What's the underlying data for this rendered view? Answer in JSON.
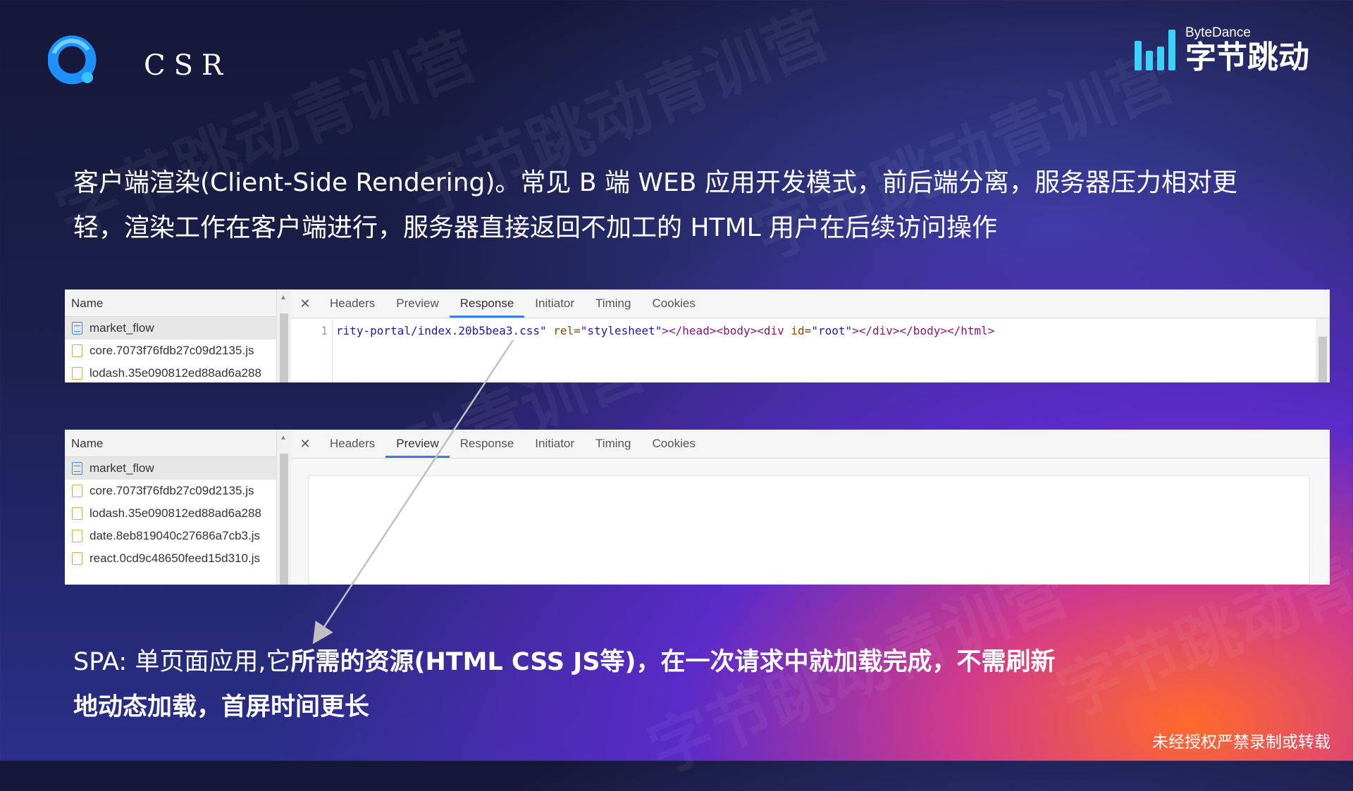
{
  "header": {
    "title": "CSR",
    "brand_en": "ByteDance",
    "brand_cn": "字节跳动"
  },
  "intro_text": "客户端渲染(Client-Side Rendering)。常见 B 端 WEB 应用开发模式，前后端分离，服务器压力相对更轻，渲染工作在客户端进行，服务器直接返回不加工的 HTML 用户在后续访问操作",
  "watermark": "字节跳动青训营",
  "devtools_response": {
    "sidebar_header": "Name",
    "files": [
      "market_flow",
      "core.7073f76fdb27c09d2135.js",
      "lodash.35e090812ed88ad6a288"
    ],
    "tabs": [
      "Headers",
      "Preview",
      "Response",
      "Initiator",
      "Timing",
      "Cookies"
    ],
    "active_tab": "Response",
    "line_number": "1",
    "code": {
      "str1": "rity-portal/index.20b5bea3.css\"",
      "attr1": " rel=",
      "str2": "\"stylesheet\"",
      "tag1": "></head><body><div",
      "attr2": " id=",
      "str3": "\"root\"",
      "tag2": "></div></body></html>"
    }
  },
  "devtools_preview": {
    "sidebar_header": "Name",
    "files": [
      "market_flow",
      "core.7073f76fdb27c09d2135.js",
      "lodash.35e090812ed88ad6a288",
      "date.8eb819040c27686a7cb3.js",
      "react.0cd9c48650feed15d310.js"
    ],
    "tabs": [
      "Headers",
      "Preview",
      "Response",
      "Initiator",
      "Timing",
      "Cookies"
    ],
    "active_tab": "Preview"
  },
  "spa": {
    "prefix": "SPA: 单页面应用,它",
    "bold1": "所需的资源(HTML CSS JS等)，在一次请求中就加载完成，不需刷新地动态加载，首屏时间更长"
  },
  "footer": "未经授权严禁录制或转载",
  "colors": {
    "tab_active_underline": "#3b7ddb",
    "brand_accent": "#3ad1ff",
    "logo_blue": "#1e90ff"
  }
}
